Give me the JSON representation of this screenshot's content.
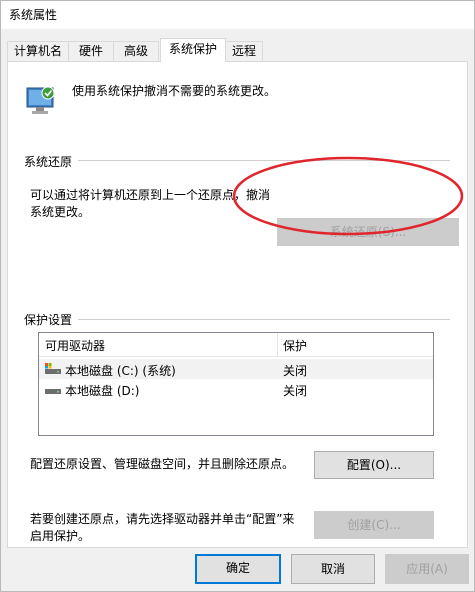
{
  "window": {
    "title": "系统属性"
  },
  "tabs": [
    {
      "label": "计算机名"
    },
    {
      "label": "硬件"
    },
    {
      "label": "高级"
    },
    {
      "label": "系统保护"
    },
    {
      "label": "远程"
    }
  ],
  "header": {
    "description": "使用系统保护撤消不需要的系统更改。",
    "icon": "computer-shield-icon"
  },
  "restore": {
    "section_label": "系统还原",
    "text_line1": "可以通过将计算机还原到上一个还原点，撤消",
    "text_line2": "系统更改。",
    "button_label": "系统还原(S)...",
    "button_enabled": false
  },
  "protection": {
    "section_label": "保护设置",
    "columns": [
      "可用驱动器",
      "保护"
    ],
    "drives": [
      {
        "name": "本地磁盘 (C:) (系统)",
        "status": "关闭",
        "icon": "system-drive-icon"
      },
      {
        "name": "本地磁盘 (D:)",
        "status": "关闭",
        "icon": "drive-icon"
      }
    ],
    "configure_text": "配置还原设置、管理磁盘空间，并且删除还原点。",
    "configure_button": "配置(O)...",
    "create_text_line1": "若要创建还原点，请先选择驱动器并单击“配置”来",
    "create_text_line2": "启用保护。",
    "create_button": "创建(C)..."
  },
  "footer": {
    "ok": "确定",
    "cancel": "取消",
    "apply": "应用(A)"
  },
  "colors": {
    "annotation": "#e0262c",
    "accent": "#0078d7"
  }
}
